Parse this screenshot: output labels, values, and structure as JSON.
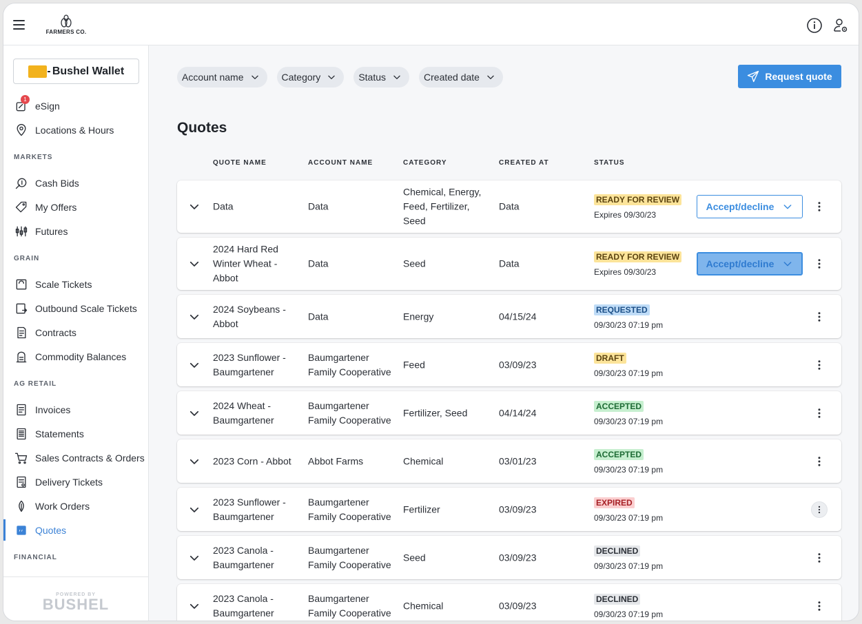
{
  "brand": {
    "name": "FARMERS CO."
  },
  "topbar": {
    "info_icon": "info-circle-icon",
    "user_icon": "user-settings-icon"
  },
  "sidebar": {
    "wallet_label": "Bushel Wallet",
    "esign_badge": "1",
    "top_items": [
      {
        "label": "eSign",
        "icon": "esign-icon"
      },
      {
        "label": "Locations & Hours",
        "icon": "map-pin-icon"
      }
    ],
    "sections": [
      {
        "label": "MARKETS",
        "items": [
          {
            "label": "Cash Bids",
            "icon": "cash-bids-icon"
          },
          {
            "label": "My Offers",
            "icon": "tag-icon"
          },
          {
            "label": "Futures",
            "icon": "futures-icon"
          }
        ]
      },
      {
        "label": "GRAIN",
        "items": [
          {
            "label": "Scale Tickets",
            "icon": "scale-ticket-icon"
          },
          {
            "label": "Outbound Scale Tickets",
            "icon": "outbound-ticket-icon"
          },
          {
            "label": "Contracts",
            "icon": "contract-icon"
          },
          {
            "label": "Commodity Balances",
            "icon": "silo-icon"
          }
        ]
      },
      {
        "label": "AG RETAIL",
        "items": [
          {
            "label": "Invoices",
            "icon": "invoice-icon"
          },
          {
            "label": "Statements",
            "icon": "statement-icon"
          },
          {
            "label": "Sales Contracts & Orders",
            "icon": "cart-icon"
          },
          {
            "label": "Delivery Tickets",
            "icon": "delivery-ticket-icon"
          },
          {
            "label": "Work Orders",
            "icon": "work-order-icon"
          },
          {
            "label": "Quotes",
            "icon": "quote-icon",
            "active": true
          }
        ]
      },
      {
        "label": "FINANCIAL",
        "items": []
      }
    ],
    "powered_small": "POWERED BY",
    "powered_large": "BUSHEL"
  },
  "filters": [
    "Account name",
    "Category",
    "Status",
    "Created date"
  ],
  "request_button": "Request quote",
  "page_title": "Quotes",
  "columns": [
    "QUOTE NAME",
    "ACCOUNT NAME",
    "CATEGORY",
    "CREATED AT",
    "STATUS"
  ],
  "accept_label": "Accept/decline",
  "rows": [
    {
      "name": [
        "Data"
      ],
      "account": [
        "Data"
      ],
      "category": [
        "Chemical, Energy,",
        "Feed, Fertilizer,",
        "Seed"
      ],
      "created": "Data",
      "status": "READY FOR REVIEW",
      "status_kind": "review",
      "status_sub": "Expires 09/30/23",
      "accept": "normal",
      "height": 76
    },
    {
      "name": [
        "2024 Hard Red",
        "Winter Wheat -",
        "Abbot"
      ],
      "account": [
        "Data"
      ],
      "category": [
        "Seed"
      ],
      "created": "Data",
      "status": "READY FOR REVIEW",
      "status_kind": "review",
      "status_sub": "Expires 09/30/23",
      "accept": "pressed",
      "height": 76
    },
    {
      "name": [
        "2024 Soybeans -",
        "Abbot"
      ],
      "account": [
        "Data"
      ],
      "category": [
        "Energy"
      ],
      "created": "04/15/24",
      "status": "REQUESTED",
      "status_kind": "requested",
      "status_sub": "09/30/23 07:19 pm",
      "height": 63
    },
    {
      "name": [
        "2023 Sunflower -",
        "Baumgartener"
      ],
      "account": [
        "Baumgartener",
        "Family Cooperative"
      ],
      "category": [
        "Feed"
      ],
      "created": "03/09/23",
      "status": "DRAFT",
      "status_kind": "draft",
      "status_sub": "09/30/23 07:19 pm",
      "height": 63
    },
    {
      "name": [
        "2024 Wheat -",
        "Baumgartener"
      ],
      "account": [
        "Baumgartener",
        "Family Cooperative"
      ],
      "category": [
        "Fertilizer, Seed"
      ],
      "created": "04/14/24",
      "status": "ACCEPTED",
      "status_kind": "accepted",
      "status_sub": "09/30/23 07:19 pm",
      "height": 63
    },
    {
      "name": [
        "2023 Corn - Abbot"
      ],
      "account": [
        "Abbot Farms"
      ],
      "category": [
        "Chemical"
      ],
      "created": "03/01/23",
      "status": "ACCEPTED",
      "status_kind": "accepted",
      "status_sub": "09/30/23 07:19 pm",
      "height": 63
    },
    {
      "name": [
        "2023 Sunflower -",
        "Baumgartener"
      ],
      "account": [
        "Baumgartener",
        "Family Cooperative"
      ],
      "category": [
        "Fertilizer"
      ],
      "created": "03/09/23",
      "status": "EXPIRED",
      "status_kind": "expired",
      "status_sub": "09/30/23 07:19 pm",
      "kebab_hover": true,
      "height": 63
    },
    {
      "name": [
        "2023 Canola -",
        "Baumgartener"
      ],
      "account": [
        "Baumgartener",
        "Family Cooperative"
      ],
      "category": [
        "Seed"
      ],
      "created": "03/09/23",
      "status": "DECLINED",
      "status_kind": "declined",
      "status_sub": "09/30/23 07:19 pm",
      "height": 63
    },
    {
      "name": [
        "2023 Canola -",
        "Baumgartener"
      ],
      "account": [
        "Baumgartener",
        "Family Cooperative"
      ],
      "category": [
        "Chemical"
      ],
      "created": "03/09/23",
      "status": "DECLINED",
      "status_kind": "declined",
      "status_sub": "09/30/23 07:19 pm",
      "height": 63
    }
  ],
  "colors": {
    "accent": "#3b8de0",
    "active_nav": "#3b82d6",
    "ready": "#fce49a",
    "accepted": "#c6efcf",
    "expired": "#fbcfd0",
    "requested": "#bfdcf7",
    "declined": "#e5e7ea"
  }
}
